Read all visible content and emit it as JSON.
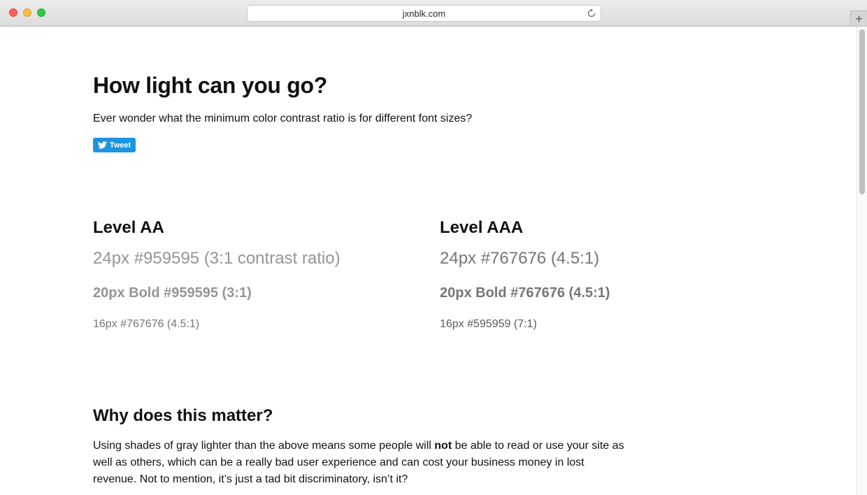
{
  "browser": {
    "url": "jxnblk.com",
    "new_tab": "+"
  },
  "page": {
    "title": "How light can you go?",
    "intro": "Ever wonder what the minimum color contrast ratio is for different font sizes?",
    "tweet_label": "Tweet"
  },
  "levels": [
    {
      "title": "Level AA",
      "samples": [
        {
          "text": "24px #959595 (3:1 contrast ratio)",
          "color": "#959595"
        },
        {
          "text": "20px Bold #959595 (3:1)",
          "color": "#959595"
        },
        {
          "text": "16px #767676 (4.5:1)",
          "color": "#767676"
        }
      ]
    },
    {
      "title": "Level AAA",
      "samples": [
        {
          "text": "24px #767676 (4.5:1)",
          "color": "#767676"
        },
        {
          "text": "20px Bold #767676 (4.5:1)",
          "color": "#767676"
        },
        {
          "text": "16px #595959 (7:1)",
          "color": "#595959"
        }
      ]
    }
  ],
  "why": {
    "title": "Why does this matter?",
    "text_before": "Using shades of gray lighter than the above means some people will ",
    "emphasis": "not",
    "text_after": " be able to read or use your site as well as others, which can be a really bad user experience and can cost your business money in lost revenue. Not to mention, it’s just a tad bit discriminatory, isn’t it?"
  },
  "colors": {
    "tweet_button": "#1b95e0",
    "heading": "#111111"
  },
  "icons": [
    "reload-icon",
    "twitter-bird-icon"
  ]
}
